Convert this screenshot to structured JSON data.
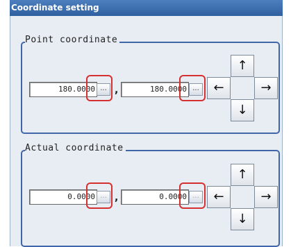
{
  "window": {
    "title": "Coordinate setting"
  },
  "point_group": {
    "label": "Point coordinate",
    "x_value": "180.0000",
    "y_value": "180.0000",
    "browse_label": "...",
    "separator": ",",
    "arrows": {
      "up": "↑",
      "down": "↓",
      "left": "←",
      "right": "→"
    }
  },
  "actual_group": {
    "label": "Actual coordinate",
    "x_value": "0.0000",
    "y_value": "0.0000",
    "browse_label": "...",
    "separator": ",",
    "arrows": {
      "up": "↑",
      "down": "↓",
      "left": "←",
      "right": "→"
    }
  },
  "colors": {
    "title_bar": "#2f5f9f",
    "group_border": "#3f66a8",
    "highlight": "#d62f2f",
    "panel_background": "#e8edf3"
  }
}
